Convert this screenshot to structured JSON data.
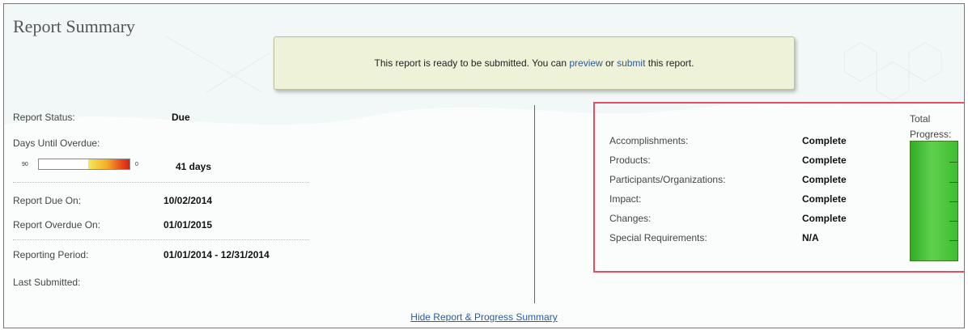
{
  "title": "Report Summary",
  "notice": {
    "text_before": "This report is ready to be submitted.  You can ",
    "preview_link": "preview",
    "text_middle": " or ",
    "submit_link": "submit",
    "text_after": " this report."
  },
  "status": {
    "report_status_label": "Report Status:",
    "report_status_value": "Due",
    "days_until_overdue_label": "Days Until Overdue:",
    "gauge_min_label": "90",
    "gauge_max_label": "0",
    "days_until_overdue_value": "41 days",
    "days_remaining_fraction": 0.455,
    "report_due_label": "Report Due On:",
    "report_due_value": "10/02/2014",
    "report_overdue_label": "Report Overdue On:",
    "report_overdue_value": "01/01/2015",
    "reporting_period_label": "Reporting Period:",
    "reporting_period_value": "01/01/2014 - 12/31/2014",
    "last_submitted_label": "Last Submitted:",
    "last_submitted_value": ""
  },
  "sections": [
    {
      "label": "Accomplishments:",
      "value": "Complete"
    },
    {
      "label": "Products:",
      "value": "Complete"
    },
    {
      "label": "Participants/Organizations:",
      "value": "Complete"
    },
    {
      "label": "Impact:",
      "value": "Complete"
    },
    {
      "label": "Changes:",
      "value": "Complete"
    },
    {
      "label": "Special Requirements:",
      "value": "N/A"
    }
  ],
  "total_progress": {
    "label_line1": "Total",
    "label_line2": "Progress:",
    "percent": 100
  },
  "footer_link": "Hide Report & Progress Summary",
  "colors": {
    "link": "#2b5aa0",
    "highlight_border": "#e54d62",
    "progress_green": "#3fbd32"
  }
}
